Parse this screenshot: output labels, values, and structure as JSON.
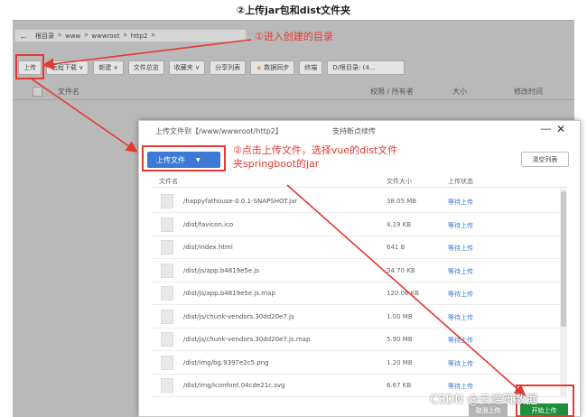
{
  "doc_title": "②上传jar包和dist文件夹",
  "breadcrumb": {
    "back_glyph": "←",
    "items": [
      "根目录",
      "www",
      "wwwroot",
      "http2"
    ],
    "separator": ">"
  },
  "annotation_1": "①进入创建的目录",
  "toolbar": {
    "buttons": [
      "上传",
      "远程下载 ∨",
      "新建 ∨",
      "文件总览",
      "收藏夹 ∨",
      "分享列表",
      "数据同步",
      "终端",
      "D/根目录: (4..."
    ],
    "favorite_glyph": "★"
  },
  "list_header": {
    "name": "文件名",
    "permission_owner": "权限 / 所有者",
    "size": "大小",
    "modified": "修改时间"
  },
  "dialog": {
    "title": "上传文件到【/www/wwwroot/http2】",
    "support": "支持断点续传",
    "minimize": "—",
    "close": "✕",
    "upload_button": "上传文件",
    "upload_caret": "▼",
    "clear_button": "清空列表",
    "col_name": "文件名",
    "col_size": "文件大小",
    "col_status": "上传状态",
    "cancel_button": "取消上传",
    "start_button": "开始上传",
    "files": [
      {
        "name": "/happyfathouse-0.0.1-SNAPSHOT.jar",
        "size": "38.05 MB",
        "status": "等待上传"
      },
      {
        "name": "/dist/favicon.ico",
        "size": "4.19 KB",
        "status": "等待上传"
      },
      {
        "name": "/dist/index.html",
        "size": "641 B",
        "status": "等待上传"
      },
      {
        "name": "/dist/js/app.b4819e5e.js",
        "size": "34.70 KB",
        "status": "等待上传"
      },
      {
        "name": "/dist/js/app.b4819e5e.js.map",
        "size": "120.06 KB",
        "status": "等待上传"
      },
      {
        "name": "/dist/js/chunk-vendors.30dd20e7.js",
        "size": "1.00 MB",
        "status": "等待上传"
      },
      {
        "name": "/dist/js/chunk-vendors.30dd20e7.js.map",
        "size": "5.90 MB",
        "status": "等待上传"
      },
      {
        "name": "/dist/img/bg.9397e2c5.png",
        "size": "1.20 MB",
        "status": "等待上传"
      },
      {
        "name": "/dist/img/iconfont.04cde21c.svg",
        "size": "6.67 KB",
        "status": "等待上传"
      }
    ]
  },
  "annotation_2": "②点击上传文件，选择vue的dist文件夹springboot的jar",
  "watermark": "CSDN @云端筑数据",
  "colors": {
    "annotation_red": "#e53935",
    "upload_blue": "#3d7ad6",
    "start_green": "#1e8f3a",
    "overlay_gray": "#b9b9b9"
  }
}
